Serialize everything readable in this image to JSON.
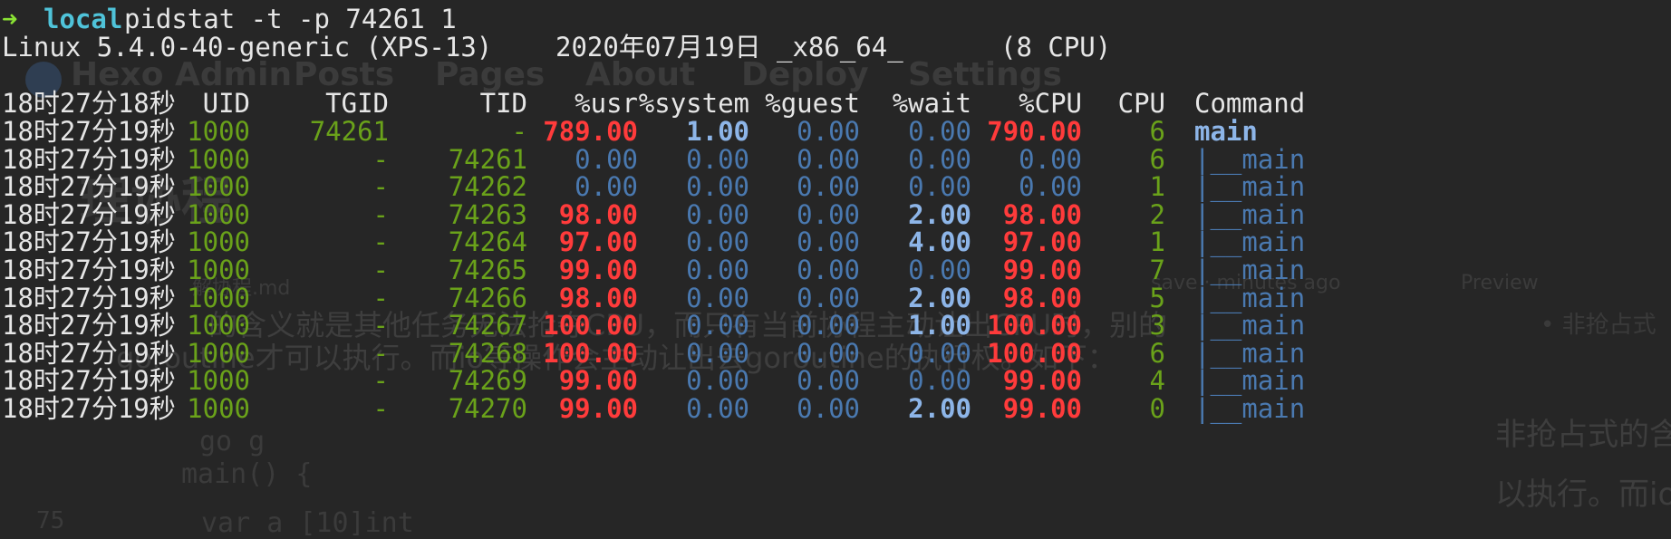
{
  "prompt": {
    "arrow": "➜",
    "dir": "local",
    "command": "pidstat -t -p 74261 1"
  },
  "sysinfo": {
    "kernel": "Linux 5.4.0-40-generic (XPS-13)",
    "date": "2020年07月19日",
    "arch": "_x86_64_",
    "cpus": "(8 CPU)"
  },
  "background_page": {
    "nav": [
      "Hexo Admin",
      "Posts",
      "Pages",
      "About",
      "Deploy",
      "Settings"
    ],
    "heading": "理协程",
    "file": "解协程.md",
    "meta": "save · minutes ago",
    "preview": "Preview",
    "para1": "的含义就是其他任务无法抢夺CPU，而只有当前协程主动让出CPU时，别的",
    "para2": "goroutine才可以执行。而io等操作会主动让出去goroutine的执行权。如下：",
    "bullet": "• 非抢占式",
    "para3": "非抢占式的含",
    "para4": "以执行。而io",
    "code1": "go  g",
    "code2": "main() {",
    "code3": "var a [10]int",
    "line_no": "75"
  },
  "table": {
    "headers": {
      "time": "18时27分18秒",
      "uid": "UID",
      "tgid": "TGID",
      "tid": "TID",
      "usr": "%usr",
      "system": "%system",
      "guest": "%guest",
      "wait": "%wait",
      "cpu_pct": "%CPU",
      "cpu": "CPU",
      "command": "Command"
    },
    "rows": [
      {
        "time": "18时27分19秒",
        "uid": "1000",
        "tgid": "74261",
        "tid": "-",
        "usr": "789.00",
        "system": "1.00",
        "guest": "0.00",
        "wait": "0.00",
        "cpu_pct": "790.00",
        "cpu": "6",
        "command": "main"
      },
      {
        "time": "18时27分19秒",
        "uid": "1000",
        "tgid": "-",
        "tid": "74261",
        "usr": "0.00",
        "system": "0.00",
        "guest": "0.00",
        "wait": "0.00",
        "cpu_pct": "0.00",
        "cpu": "6",
        "command": "|__main"
      },
      {
        "time": "18时27分19秒",
        "uid": "1000",
        "tgid": "-",
        "tid": "74262",
        "usr": "0.00",
        "system": "0.00",
        "guest": "0.00",
        "wait": "0.00",
        "cpu_pct": "0.00",
        "cpu": "1",
        "command": "|__main"
      },
      {
        "time": "18时27分19秒",
        "uid": "1000",
        "tgid": "-",
        "tid": "74263",
        "usr": "98.00",
        "system": "0.00",
        "guest": "0.00",
        "wait": "2.00",
        "cpu_pct": "98.00",
        "cpu": "2",
        "command": "|__main"
      },
      {
        "time": "18时27分19秒",
        "uid": "1000",
        "tgid": "-",
        "tid": "74264",
        "usr": "97.00",
        "system": "0.00",
        "guest": "0.00",
        "wait": "4.00",
        "cpu_pct": "97.00",
        "cpu": "1",
        "command": "|__main"
      },
      {
        "time": "18时27分19秒",
        "uid": "1000",
        "tgid": "-",
        "tid": "74265",
        "usr": "99.00",
        "system": "0.00",
        "guest": "0.00",
        "wait": "0.00",
        "cpu_pct": "99.00",
        "cpu": "7",
        "command": "|__main"
      },
      {
        "time": "18时27分19秒",
        "uid": "1000",
        "tgid": "-",
        "tid": "74266",
        "usr": "98.00",
        "system": "0.00",
        "guest": "0.00",
        "wait": "2.00",
        "cpu_pct": "98.00",
        "cpu": "5",
        "command": "|__main"
      },
      {
        "time": "18时27分19秒",
        "uid": "1000",
        "tgid": "-",
        "tid": "74267",
        "usr": "100.00",
        "system": "0.00",
        "guest": "0.00",
        "wait": "1.00",
        "cpu_pct": "100.00",
        "cpu": "3",
        "command": "|__main"
      },
      {
        "time": "18时27分19秒",
        "uid": "1000",
        "tgid": "-",
        "tid": "74268",
        "usr": "100.00",
        "system": "0.00",
        "guest": "0.00",
        "wait": "0.00",
        "cpu_pct": "100.00",
        "cpu": "6",
        "command": "|__main"
      },
      {
        "time": "18时27分19秒",
        "uid": "1000",
        "tgid": "-",
        "tid": "74269",
        "usr": "99.00",
        "system": "0.00",
        "guest": "0.00",
        "wait": "0.00",
        "cpu_pct": "99.00",
        "cpu": "4",
        "command": "|__main"
      },
      {
        "time": "18时27分19秒",
        "uid": "1000",
        "tgid": "-",
        "tid": "74270",
        "usr": "99.00",
        "system": "0.00",
        "guest": "0.00",
        "wait": "2.00",
        "cpu_pct": "99.00",
        "cpu": "0",
        "command": "|__main"
      }
    ]
  },
  "colors": {
    "background": "#262626",
    "text": "#e6e6e6",
    "green": "#6aa21a",
    "red": "#ff3b3b",
    "blue": "#4a79b0",
    "bright_blue": "#8db5e8",
    "cyan": "#4fc3d9",
    "prompt_arrow": "#8ae234"
  }
}
